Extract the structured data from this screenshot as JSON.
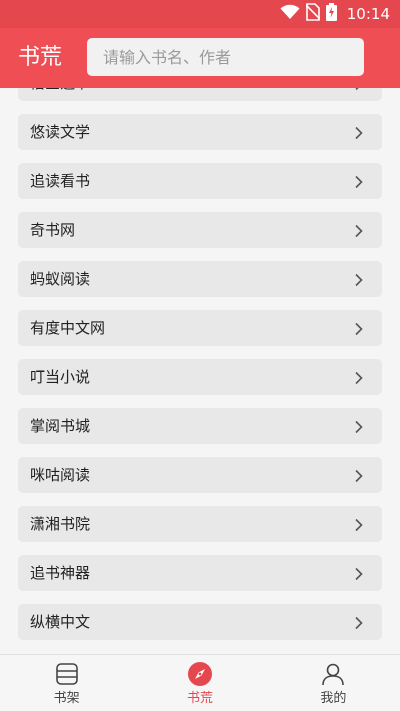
{
  "status_bar": {
    "time": "10:14",
    "icons": [
      "wifi-icon",
      "no-sim-icon",
      "battery-charging-icon"
    ]
  },
  "header": {
    "title": "书荒",
    "search": {
      "placeholder": "请输入书名、作者",
      "value": ""
    }
  },
  "list": {
    "items": [
      {
        "label": "悟空追书"
      },
      {
        "label": "悠读文学"
      },
      {
        "label": "追读看书"
      },
      {
        "label": "奇书网"
      },
      {
        "label": "蚂蚁阅读"
      },
      {
        "label": "有度中文网"
      },
      {
        "label": "叮当小说"
      },
      {
        "label": "掌阅书城"
      },
      {
        "label": "咪咕阅读"
      },
      {
        "label": "潇湘书院"
      },
      {
        "label": "追书神器"
      },
      {
        "label": "纵横中文"
      }
    ],
    "item_icon": "chevron-right-icon"
  },
  "bottom_nav": {
    "tabs": [
      {
        "label": "书架",
        "icon": "bookshelf-icon",
        "active": false
      },
      {
        "label": "书荒",
        "icon": "compass-icon",
        "active": true
      },
      {
        "label": "我的",
        "icon": "user-icon",
        "active": false
      }
    ]
  },
  "colors": {
    "accent": "#f04e55",
    "status_bar": "#e5474e",
    "item_background": "#e8e8e8"
  }
}
